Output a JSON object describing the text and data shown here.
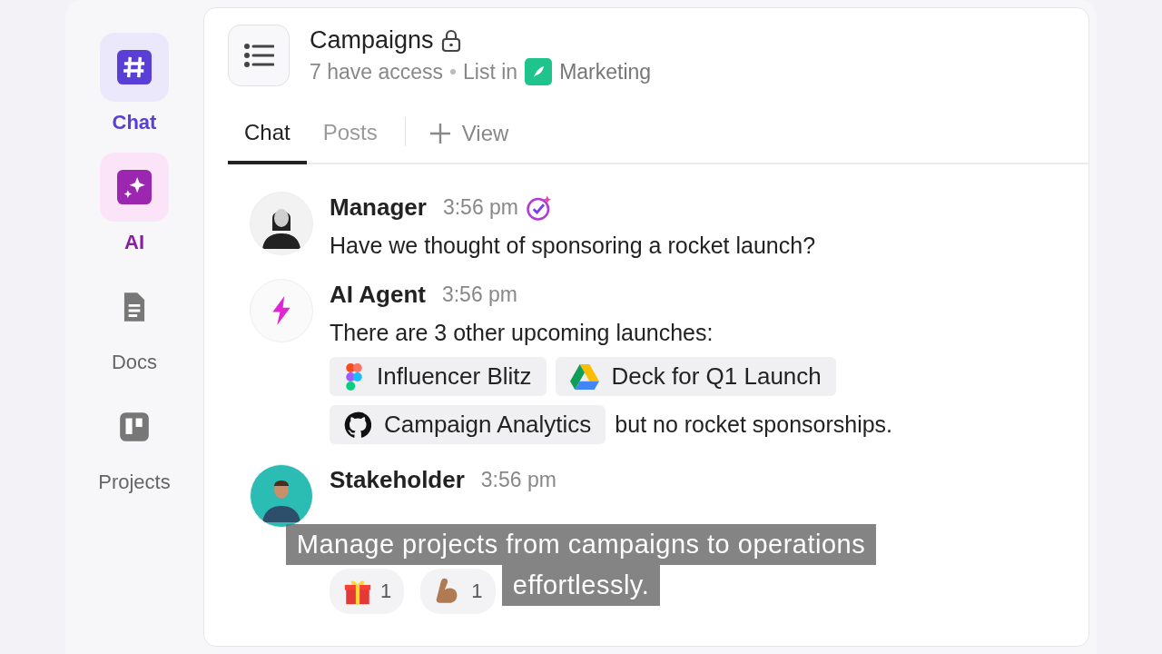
{
  "nav": [
    {
      "kind": "chat",
      "label": "Chat",
      "selected": true
    },
    {
      "kind": "ai",
      "label": "AI",
      "selected": true
    },
    {
      "kind": "docs",
      "label": "Docs",
      "selected": false
    },
    {
      "kind": "projects",
      "label": "Projects",
      "selected": false
    }
  ],
  "header": {
    "title": "Campaigns",
    "access": "7 have access",
    "list_in": "List in",
    "space": "Marketing"
  },
  "tabs": [
    {
      "label": "Chat",
      "selected": true
    },
    {
      "label": "Posts",
      "selected": false
    }
  ],
  "add_view": "View",
  "messages": [
    {
      "kind": "person",
      "author": "Manager",
      "time": "3:56 pm",
      "text": "Have we thought of sponsoring a rocket launch?",
      "verified": true
    },
    {
      "kind": "agent",
      "author": "AI Agent",
      "time": "3:56 pm",
      "text": "There are 3 other upcoming launches:",
      "chips": [
        {
          "kind": "figma",
          "label": "Influencer Blitz"
        },
        {
          "kind": "drive",
          "label": "Deck for Q1 Launch"
        },
        {
          "kind": "github",
          "label": "Campaign Analytics"
        }
      ],
      "after": "but no rocket sponsorships."
    },
    {
      "kind": "stakeholder",
      "author": "Stakeholder",
      "time": "3:56 pm",
      "reactions": [
        {
          "kind": "gift",
          "count": "1"
        },
        {
          "kind": "arm",
          "count": "1"
        }
      ]
    }
  ],
  "caption": [
    "Manage projects from campaigns to operations",
    "effortlessly."
  ]
}
